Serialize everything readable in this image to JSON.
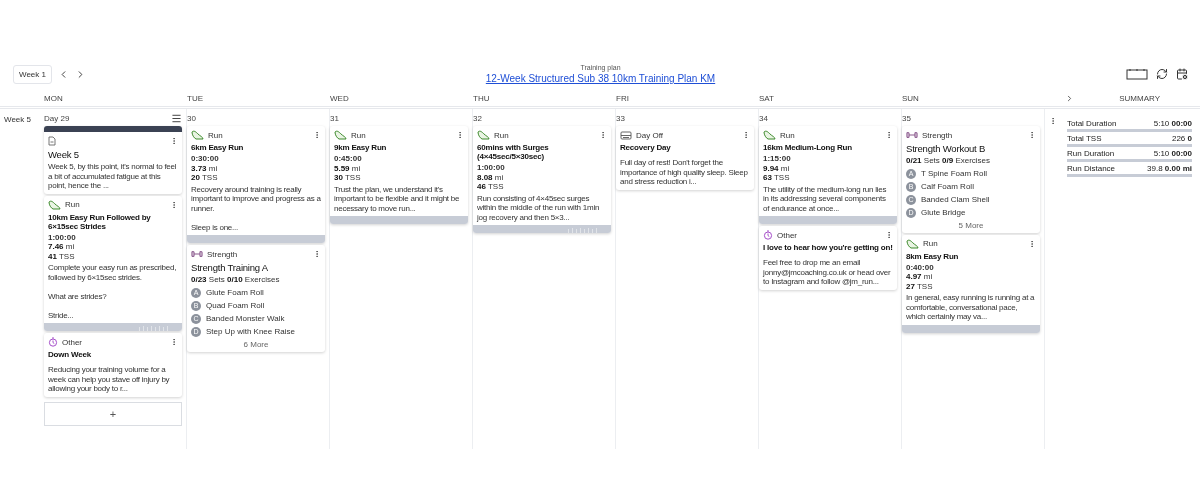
{
  "header": {
    "week_button": "Week 1",
    "subtitle": "Training plan",
    "title": "12-Week Structured Sub 38 10km Training Plan KM"
  },
  "columns": [
    "MON",
    "TUE",
    "WED",
    "THU",
    "FRI",
    "SAT",
    "SUN"
  ],
  "summary_heading": "SUMMARY",
  "week_label": "Week 5",
  "days": [
    {
      "label": "Day 29",
      "menu": true,
      "add_button": "+",
      "cards": [
        {
          "kind": "note",
          "title": "Week 5",
          "text": "Week 5, by this point, it's normal to feel a bit of accumulated fatigue at this point, hence the ..."
        },
        {
          "kind": "run",
          "type": "Run",
          "title": "10km Easy Run Followed by 6×15sec Strides",
          "duration": "1:00:00",
          "distance": "**7.46** mi",
          "tss": "**41** TSS",
          "text": "Complete your easy run as prescribed, followed by 6×15sec strides.\n\nWhat are strides?\n\nStride...",
          "profile": true
        },
        {
          "kind": "other",
          "type": "Other",
          "title": "Down Week",
          "text": "Reducing your training volume for a week can help you stave off injury by allowing your body to r..."
        }
      ]
    },
    {
      "label": "30",
      "menu": false,
      "cards": [
        {
          "kind": "run",
          "type": "Run",
          "title": "6km Easy Run",
          "duration": "0:30:00",
          "distance": "**3.73** mi",
          "tss": "**20** TSS",
          "text": "Recovery around training is really important to improve and progress as a runner.\n\nSleep is one...",
          "profile": false
        },
        {
          "kind": "strength",
          "type": "Strength",
          "title": "Strength Training A",
          "counts": "**0/23** Sets **0/10** Exercises",
          "exercises": [
            {
              "letter": "A",
              "name": "Glute Foam Roll"
            },
            {
              "letter": "B",
              "name": "Quad Foam Roll"
            },
            {
              "letter": "C",
              "name": "Banded Monster Walk"
            },
            {
              "letter": "D",
              "name": "Step Up with Knee Raise"
            }
          ],
          "more": "6 More"
        }
      ]
    },
    {
      "label": "31",
      "menu": false,
      "cards": [
        {
          "kind": "run",
          "type": "Run",
          "title": "9km Easy Run",
          "duration": "0:45:00",
          "distance": "**5.59** mi",
          "tss": "**30** TSS",
          "text": "Trust the plan, we understand it's important to be flexible and it might be necessary to move run...",
          "profile": false
        }
      ]
    },
    {
      "label": "32",
      "menu": false,
      "cards": [
        {
          "kind": "run",
          "type": "Run",
          "title": "60mins with Surges (4×45sec/5×30sec)",
          "duration": "1:00:00",
          "distance": "**8.08** mi",
          "tss": "**46** TSS",
          "text": "Run consisting of 4×45sec surges within the middle of the run with 1min jog recovery and then 5×3...",
          "profile": true
        }
      ]
    },
    {
      "label": "33",
      "menu": false,
      "cards": [
        {
          "kind": "dayoff",
          "type": "Day Off",
          "title": "Recovery Day",
          "text": "Full day of rest! Don't forget the importance of high quality sleep. Sleep and stress reduction i..."
        }
      ]
    },
    {
      "label": "34",
      "menu": false,
      "cards": [
        {
          "kind": "run",
          "type": "Run",
          "title": "16km Medium-Long Run",
          "duration": "1:15:00",
          "distance": "**9.94** mi",
          "tss": "**63** TSS",
          "text": "The utility of the medium-long run lies in its addressing several components of endurance at once...",
          "profile": false
        },
        {
          "kind": "other",
          "type": "Other",
          "title": "I love to hear how you're getting on!",
          "text": "Feel free to drop me an email jonny@jmcoaching.co.uk or head over to Instagram and follow @jm_run..."
        }
      ]
    },
    {
      "label": "35",
      "menu": false,
      "cards": [
        {
          "kind": "strength",
          "type": "Strength",
          "title": "Strength Workout B",
          "counts": "**0/21** Sets **0/9** Exercises",
          "exercises": [
            {
              "letter": "A",
              "name": "T Spine Foam Roll"
            },
            {
              "letter": "B",
              "name": "Calf Foam Roll"
            },
            {
              "letter": "C",
              "name": "Banded Clam Shell"
            },
            {
              "letter": "D",
              "name": "Glute Bridge"
            }
          ],
          "more": "5 More"
        },
        {
          "kind": "run",
          "type": "Run",
          "title": "8km Easy Run",
          "duration": "0:40:00",
          "distance": "**4.97** mi",
          "tss": "**27** TSS",
          "text": "In general, easy running is running at a comfortable, conversational pace, which certainly may va...",
          "profile": false
        }
      ]
    }
  ],
  "summary": [
    {
      "label": "Total Duration",
      "value": "5:10 **00:00**"
    },
    {
      "label": "Total TSS",
      "value": "226 **0**"
    },
    {
      "label": "Run Duration",
      "value": "5:10 **00:00**"
    },
    {
      "label": "Run Distance",
      "value": "39.8 **0.00 mi**"
    }
  ]
}
